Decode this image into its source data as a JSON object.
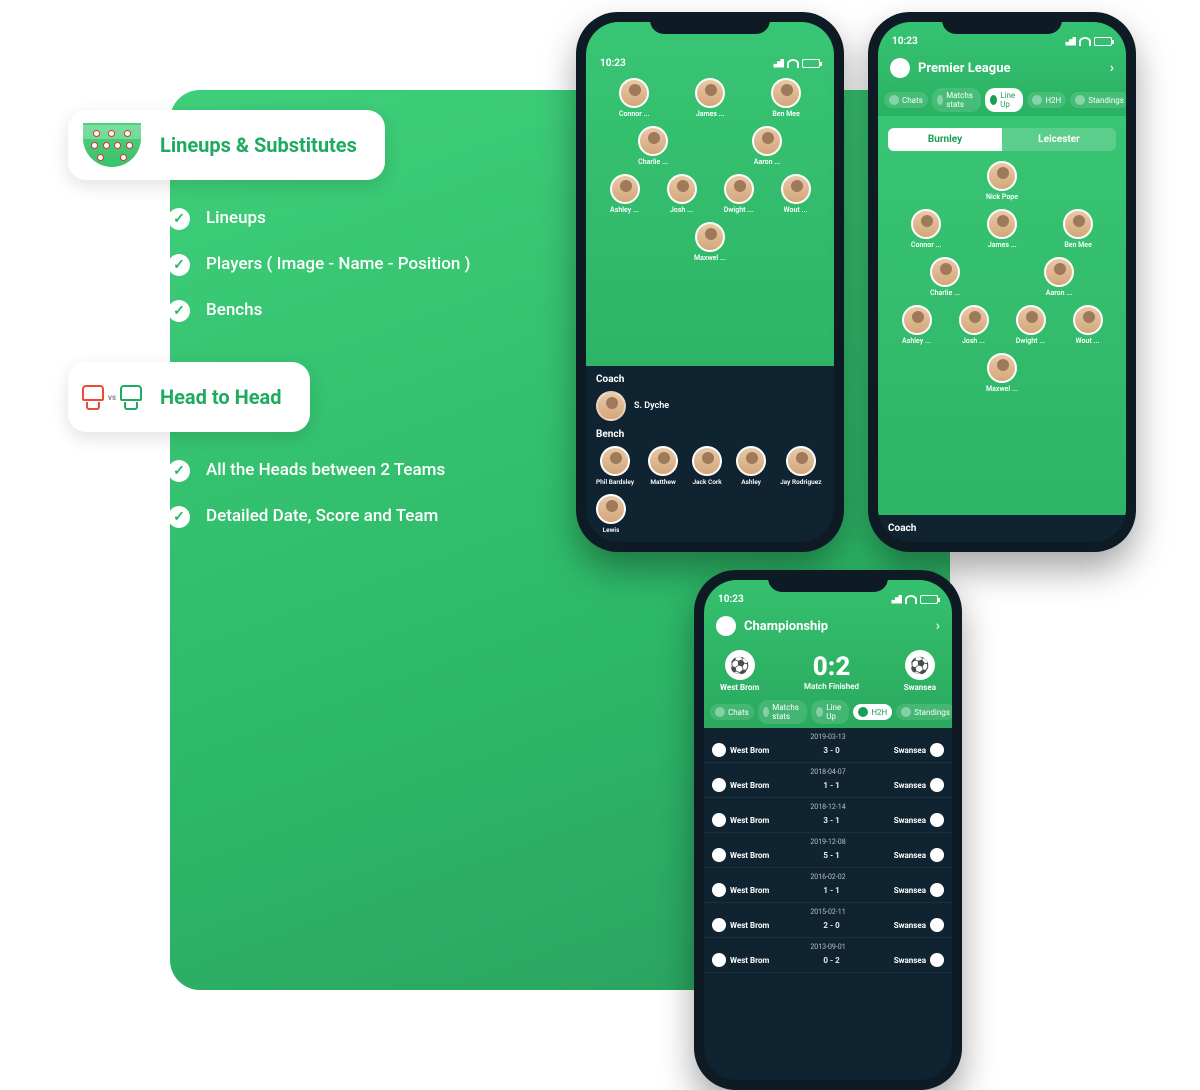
{
  "section1": {
    "title": "Lineups & Substitutes",
    "items": [
      "Lineups",
      "Players ( Image - Name - Position )",
      "Benchs"
    ]
  },
  "section2": {
    "title": "Head to Head",
    "items": [
      "All the Heads between 2 Teams",
      "Detailed Date, Score and Team"
    ]
  },
  "status_time": "10:23",
  "phone1": {
    "coach_label": "Coach",
    "coach_name": "S. Dyche",
    "bench_label": "Bench",
    "lineup": {
      "r1": [
        "Connor ...",
        "James ...",
        "Ben Mee"
      ],
      "r2": [
        "Charlie ...",
        "Aaron ..."
      ],
      "r3": [
        "Ashley ...",
        "Josh ...",
        "Dwight ...",
        "Wout ..."
      ],
      "r4": [
        "Maxwel ..."
      ]
    },
    "bench": [
      "Phil Bardsley",
      "Matthew",
      "Jack Cork",
      "Ashley",
      "Jay Rodriguez",
      "Lewis"
    ]
  },
  "phone2": {
    "league": "Premier League",
    "tabs": [
      "Chats",
      "Matchs stats",
      "Line Up",
      "H2H",
      "Standings"
    ],
    "active_tab": "Line Up",
    "team_a": "Burnley",
    "team_b": "Leicester",
    "lineup": {
      "r1": [
        "Nick Pope"
      ],
      "r2": [
        "Connor ...",
        "James ...",
        "Ben Mee"
      ],
      "r3": [
        "Charlie ...",
        "Aaron ..."
      ],
      "r4": [
        "Ashley ...",
        "Josh ...",
        "Dwight ...",
        "Wout ..."
      ],
      "r5": [
        "Maxwel ..."
      ]
    },
    "coach_label": "Coach"
  },
  "phone3": {
    "league": "Championship",
    "team_a": "West Brom",
    "team_b": "Swansea",
    "score": "0:2",
    "match_status": "Match Finished",
    "tabs": [
      "Chats",
      "Matchs stats",
      "Line Up",
      "H2H",
      "Standings"
    ],
    "active_tab": "H2H",
    "h2h": [
      {
        "date": "2019-03-13",
        "home": "West Brom",
        "score": "3 - 0",
        "away": "Swansea"
      },
      {
        "date": "2018-04-07",
        "home": "West Brom",
        "score": "1 - 1",
        "away": "Swansea"
      },
      {
        "date": "2018-12-14",
        "home": "West Brom",
        "score": "3 - 1",
        "away": "Swansea"
      },
      {
        "date": "2019-12-08",
        "home": "West Brom",
        "score": "5 - 1",
        "away": "Swansea"
      },
      {
        "date": "2016-02-02",
        "home": "West Brom",
        "score": "1 - 1",
        "away": "Swansea"
      },
      {
        "date": "2015-02-11",
        "home": "West Brom",
        "score": "2 - 0",
        "away": "Swansea"
      },
      {
        "date": "2013-09-01",
        "home": "West Brom",
        "score": "0 - 2",
        "away": "Swansea"
      }
    ]
  }
}
